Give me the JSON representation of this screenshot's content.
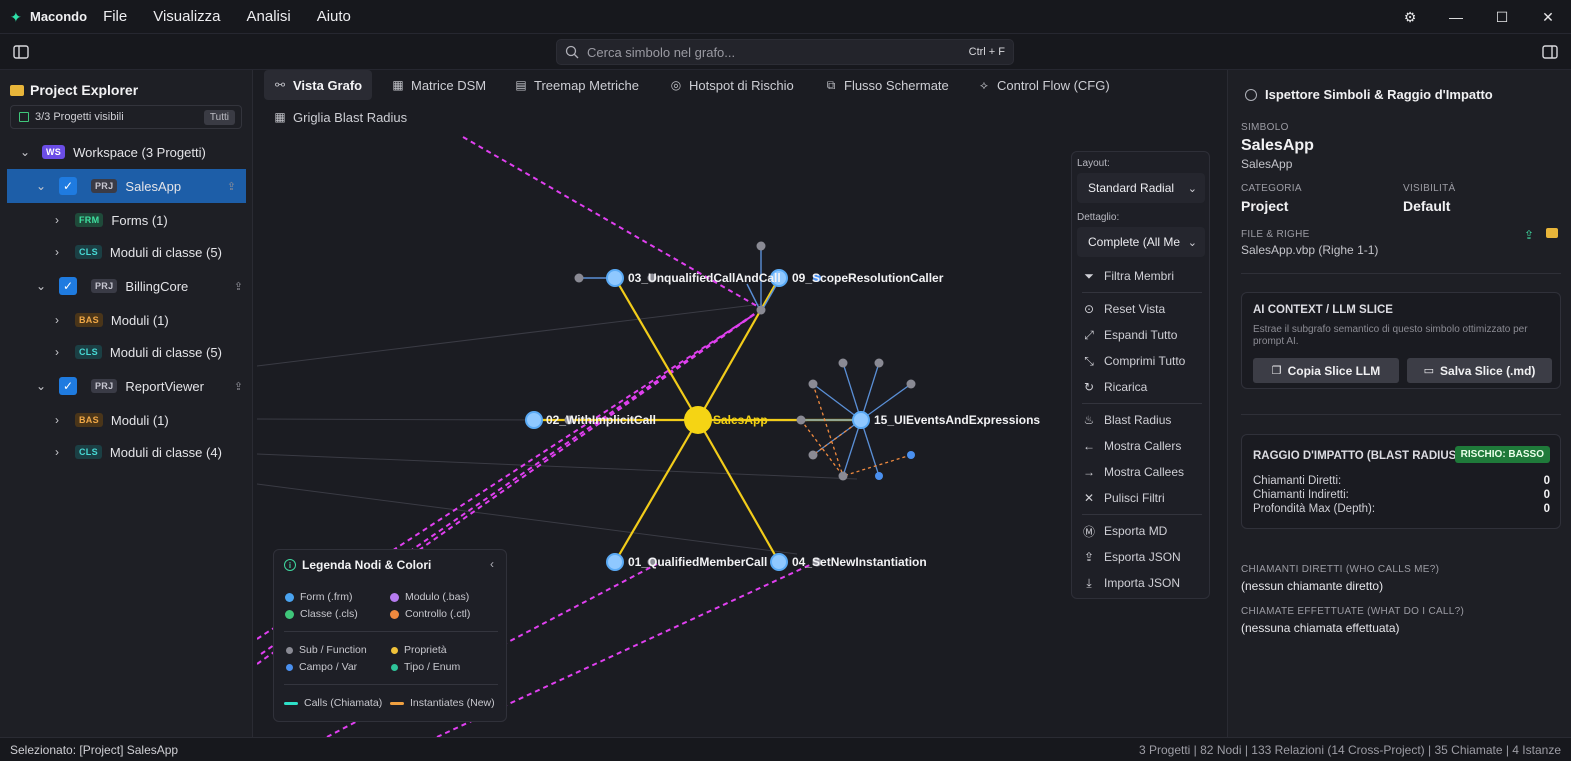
{
  "app": {
    "name": "Macondo"
  },
  "menu": [
    "File",
    "Visualizza",
    "Analisi",
    "Aiuto"
  ],
  "search": {
    "placeholder": "Cerca simbolo nel grafo...",
    "shortcut": "Ctrl + F"
  },
  "sidebar": {
    "title": "Project Explorer",
    "visible_projects": "3/3 Progetti visibili",
    "all_button": "Tutti",
    "tree": [
      {
        "badge": "WS",
        "label": "Workspace (3 Progetti)"
      },
      {
        "badge": "PRJ",
        "label": "SalesApp"
      },
      {
        "badge": "FRM",
        "label": "Forms (1)"
      },
      {
        "badge": "CLS",
        "label": "Moduli di classe (5)"
      },
      {
        "badge": "PRJ",
        "label": "BillingCore"
      },
      {
        "badge": "BAS",
        "label": "Moduli (1)"
      },
      {
        "badge": "CLS",
        "label": "Moduli di classe (5)"
      },
      {
        "badge": "PRJ",
        "label": "ReportViewer"
      },
      {
        "badge": "BAS",
        "label": "Moduli (1)"
      },
      {
        "badge": "CLS",
        "label": "Moduli di classe (4)"
      }
    ]
  },
  "tabs": [
    "Vista Grafo",
    "Matrice DSM",
    "Treemap Metriche",
    "Hotspot di Rischio",
    "Flusso Schermate",
    "Control Flow (CFG)",
    "Griglia Blast Radius"
  ],
  "graph": {
    "nodes": {
      "center": "SalesApp",
      "n03": "03_UnqualifiedCallAndCall",
      "n09": "09_ScopeResolutionCaller",
      "n02": "02_WithImplicitCall",
      "n15": "15_UIEventsAndExpressions",
      "n01": "01_QualifiedMemberCall",
      "n04": "04_SetNewInstantiation"
    }
  },
  "layout_panel": {
    "layout_label": "Layout:",
    "layout_value": "Standard Radial",
    "detail_label": "Dettaglio:",
    "detail_value": "Complete (All Me",
    "items": [
      "Filtra Membri",
      "Reset Vista",
      "Espandi Tutto",
      "Comprimi Tutto",
      "Ricarica",
      "Blast Radius",
      "Mostra Callers",
      "Mostra Callees",
      "Pulisci Filtri",
      "Esporta MD",
      "Esporta JSON",
      "Importa JSON"
    ]
  },
  "legend": {
    "title": "Legenda Nodi & Colori",
    "items": [
      "Form (.frm)",
      "Modulo (.bas)",
      "Classe (.cls)",
      "Controllo (.ctl)",
      "Sub / Function",
      "Proprietà",
      "Campo / Var",
      "Tipo / Enum",
      "Calls (Chiamata)",
      "Instantiates (New)"
    ],
    "colors": {
      "form": "#4aa3f0",
      "modulo": "#b67cf0",
      "classe": "#3fc67a",
      "controllo": "#f08a3f",
      "sub": "#8a8a94",
      "prop": "#f0c23a",
      "campo": "#4a90f0",
      "tipo": "#2ec49a",
      "calls": "#2ee0c8",
      "new": "#f0a040"
    }
  },
  "inspector": {
    "title": "Ispettore Simboli & Raggio d'Impatto",
    "symbol_caption": "SIMBOLO",
    "symbol_name": "SalesApp",
    "symbol_sub": "SalesApp",
    "category_caption": "CATEGORIA",
    "category_value": "Project",
    "visibility_caption": "VISIBILITÀ",
    "visibility_value": "Default",
    "file_caption": "FILE & RIGHE",
    "file_value": "SalesApp.vbp (Righe 1-1)",
    "ai_title": "AI CONTEXT / LLM SLICE",
    "ai_desc": "Estrae il subgrafo semantico di questo simbolo ottimizzato per prompt AI.",
    "copy_button": "Copia Slice LLM",
    "save_button": "Salva Slice (.md)",
    "blast_title": "RAGGIO D'IMPATTO (BLAST RADIUS)",
    "risk_badge": "RISCHIO: BASSO",
    "direct_callers_label": "Chiamanti Diretti:",
    "direct_callers_value": "0",
    "indirect_callers_label": "Chiamanti Indiretti:",
    "indirect_callers_value": "0",
    "depth_label": "Profondità Max (Depth):",
    "depth_value": "0",
    "who_calls_caption": "CHIAMANTI DIRETTI (WHO CALLS ME?)",
    "who_calls_value": "(nessun chiamante diretto)",
    "what_calls_caption": "CHIAMATE EFFETTUATE (WHAT DO I CALL?)",
    "what_calls_value": "(nessuna chiamata effettuata)"
  },
  "status": {
    "selected": "Selezionato: [Project] SalesApp",
    "summary": "3 Progetti | 82 Nodi | 133 Relazioni (14 Cross-Project) | 35 Chiamate | 4 Istanze"
  }
}
